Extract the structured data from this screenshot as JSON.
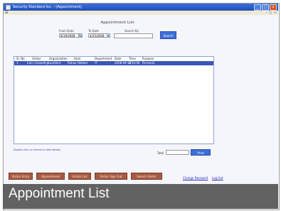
{
  "window": {
    "title": "Security Standard Inc. - [Appointment]",
    "buttons": [
      "_",
      "□",
      "x"
    ]
  },
  "menubar": {
    "system_icon": "⊞",
    "mdi_controls": "- □ x"
  },
  "page": {
    "heading": "Appointment List"
  },
  "filters": {
    "from_date_label": "From Date",
    "from_date_value": "8/19/2008",
    "to_date_label": "To Date",
    "to_date_value": "4/25/2008",
    "search_by_label": "Search By",
    "search_value": "",
    "search_button": "Search"
  },
  "table": {
    "columns": [
      "Sl. No",
      "Visitor",
      "Organization",
      "Host",
      "Department",
      "Date",
      "Time",
      "Purpose"
    ],
    "rows": [
      [
        "1",
        "Irain Chowdhry",
        "Excellent",
        "Rohan Hebbar",
        "IT",
        "2008-09-18",
        "2:50:00",
        "Personal"
      ]
    ]
  },
  "hint": "Double click on record to view details.",
  "total": {
    "label": "Total",
    "value": ""
  },
  "print_button": "Print",
  "nav": {
    "buttons": [
      "Visitor Entry",
      "Appointment",
      "Visitor List",
      "Visitor Sign Out",
      "Search Visitor"
    ],
    "change_password": "Change Password",
    "log_out": "Log Out"
  },
  "caption": "Appointment List",
  "colors": {
    "accent": "#3f6fd8",
    "nav_button": "#a75a42",
    "selected_row": "#3a57b8"
  }
}
